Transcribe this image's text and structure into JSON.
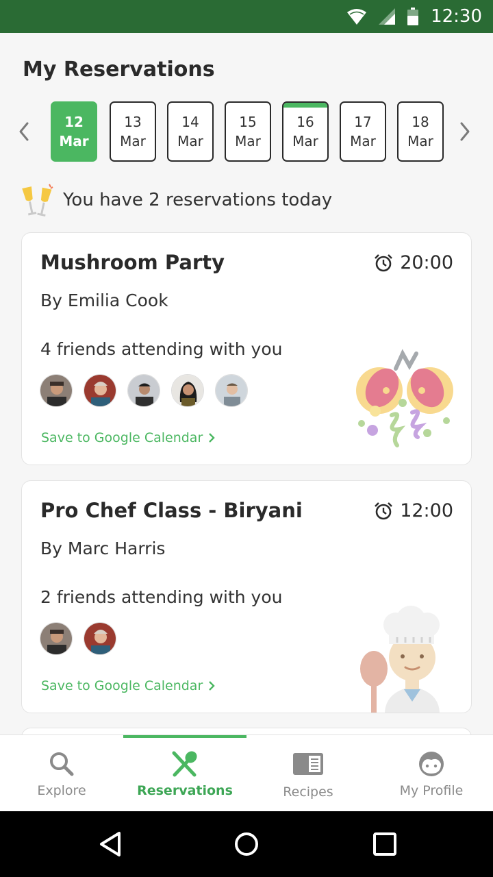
{
  "status_bar": {
    "time": "12:30"
  },
  "page": {
    "title": "My Reservations"
  },
  "dates": [
    {
      "day": "12",
      "month": "Mar",
      "selected": true,
      "has_event": false
    },
    {
      "day": "13",
      "month": "Mar",
      "selected": false,
      "has_event": false
    },
    {
      "day": "14",
      "month": "Mar",
      "selected": false,
      "has_event": false
    },
    {
      "day": "15",
      "month": "Mar",
      "selected": false,
      "has_event": false
    },
    {
      "day": "16",
      "month": "Mar",
      "selected": false,
      "has_event": true
    },
    {
      "day": "17",
      "month": "Mar",
      "selected": false,
      "has_event": false
    },
    {
      "day": "18",
      "month": "Mar",
      "selected": false,
      "has_event": false
    }
  ],
  "summary": {
    "text": "You have 2 reservations today"
  },
  "reservations": [
    {
      "title": "Mushroom Party",
      "time": "20:00",
      "host": "By Emilia Cook",
      "friends_text": "4 friends attending with you",
      "friend_count_shown": 5,
      "calendar_link": "Save to Google Calendar"
    },
    {
      "title": "Pro Chef Class - Biryani",
      "time": "12:00",
      "host": "By Marc Harris",
      "friends_text": "2 friends attending with you",
      "friend_count_shown": 2,
      "calendar_link": "Save to Google Calendar"
    }
  ],
  "nav": {
    "items": [
      {
        "label": "Explore",
        "icon": "search-icon"
      },
      {
        "label": "Reservations",
        "icon": "utensils-icon"
      },
      {
        "label": "Recipes",
        "icon": "recipe-book-icon"
      },
      {
        "label": "My Profile",
        "icon": "profile-face-icon"
      }
    ],
    "active": "Reservations"
  },
  "colors": {
    "accent": "#4bb761",
    "status_bar": "#2a6b34"
  }
}
